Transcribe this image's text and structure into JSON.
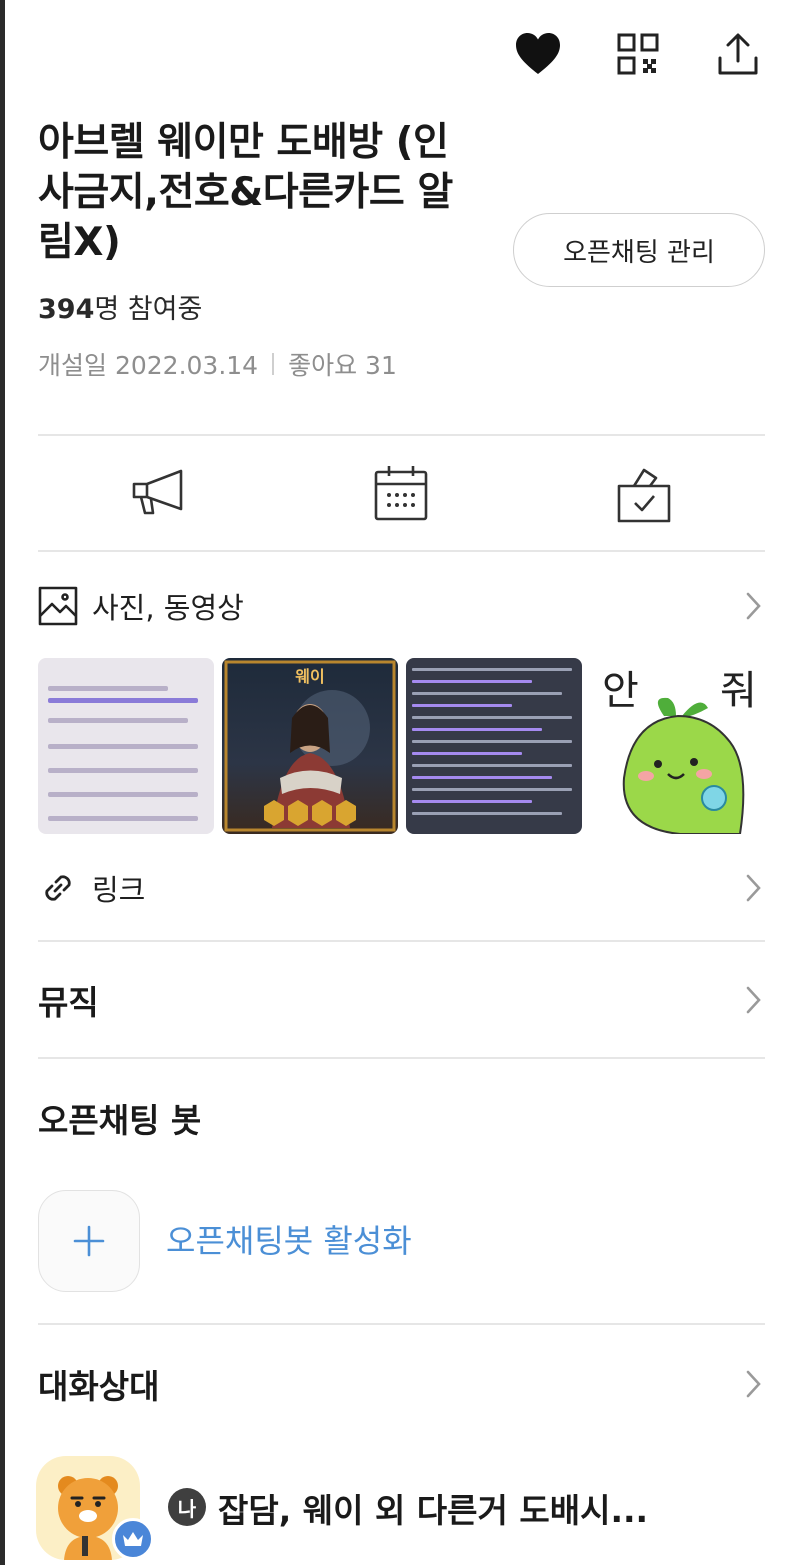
{
  "header": {
    "icons": [
      "heart-icon",
      "qr-code-icon",
      "share-icon"
    ]
  },
  "room": {
    "title": "아브렐 웨이만 도배방 (인사금지,전호&다른카드 알림X)",
    "manage_label": "오픈채팅 관리",
    "members_count": "394",
    "members_suffix": "명 참여중",
    "created_label": "개설일 2022.03.14",
    "likes_label": "좋아요 31"
  },
  "quick_actions": {
    "icons": [
      "megaphone-icon",
      "calendar-icon",
      "vote-box-icon"
    ]
  },
  "media": {
    "label": "사진, 동영상",
    "thumb2_caption": "웨이",
    "thumb4_text_left": "안",
    "thumb4_text_right": "줘"
  },
  "links": {
    "label": "링크"
  },
  "music": {
    "label": "뮤직"
  },
  "bot": {
    "heading": "오픈채팅 봇",
    "activate_label": "오픈채팅봇 활성화"
  },
  "participants": {
    "heading": "대화상대",
    "me_badge": "나",
    "first_member_name": "잡담, 웨이 외 다른거 도배시..."
  },
  "colors": {
    "accent_blue": "#4b8fd6",
    "divider": "#e6e6e6",
    "muted_text": "#8e8e8e"
  }
}
